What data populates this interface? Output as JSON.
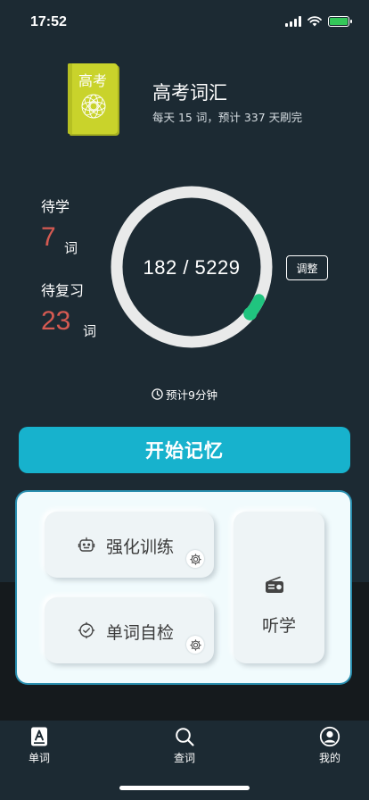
{
  "status_bar": {
    "time": "17:52"
  },
  "book": {
    "cover_title": "高考",
    "name": "高考词汇",
    "plan": "每天 15 词，预计 337 天刷完"
  },
  "stats": {
    "to_learn_label": "待学",
    "to_learn_count": "7",
    "to_review_label": "待复习",
    "to_review_count": "23",
    "unit": "词"
  },
  "progress": {
    "text": "182 / 5229",
    "learned": 182,
    "total": 5229
  },
  "adjust_label": "调整",
  "estimate": "预计9分钟",
  "start_label": "开始记忆",
  "practice": {
    "intensive": "强化训练",
    "self_check": "单词自检",
    "listening": "听学"
  },
  "nav": {
    "words": "单词",
    "lookup": "查词",
    "mine": "我的"
  },
  "colors": {
    "background": "#1c2a33",
    "accent": "#17b2cd",
    "count_red": "#d55a52",
    "progress_green": "#20c47f",
    "book_cover": "#c9d32b"
  }
}
